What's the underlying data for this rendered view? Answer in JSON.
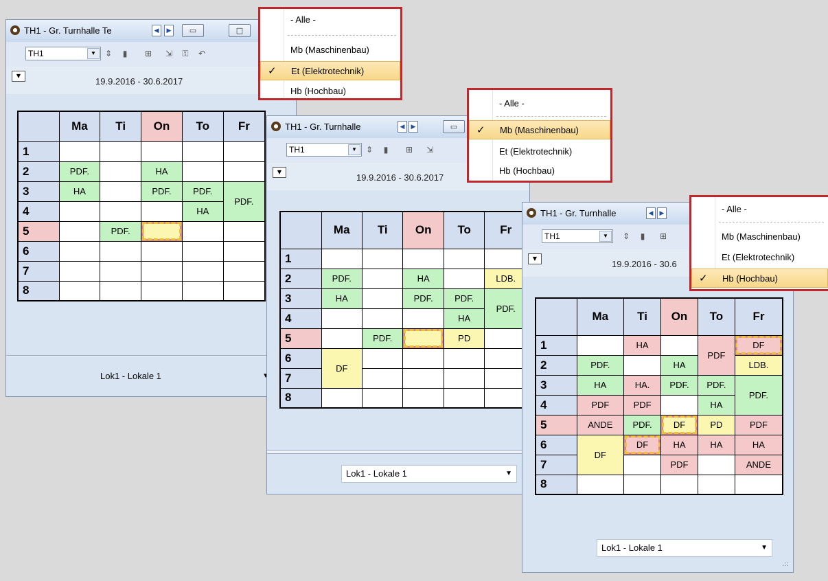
{
  "windows": [
    {
      "title": "TH1 - Gr. Turnhalle Te",
      "room_combo": "TH1",
      "date_range": "19.9.2016 - 30.6.2017",
      "days": [
        "Ma",
        "Ti",
        "On",
        "To",
        "Fr"
      ],
      "periods": [
        "1",
        "2",
        "3",
        "4",
        "5",
        "6",
        "7",
        "8"
      ],
      "footer_combo": "Lok1 - Lokale 1",
      "lesson_cells": [
        "PDF.",
        "HA",
        "HA",
        "PDF.",
        "PDF.",
        "PDF.",
        "HA",
        "PDF."
      ]
    },
    {
      "title": "TH1 - Gr. Turnhalle",
      "room_combo": "TH1",
      "date_range": "19.9.2016 - 30.6.2017",
      "days": [
        "Ma",
        "Ti",
        "On",
        "To",
        "Fr"
      ],
      "periods": [
        "1",
        "2",
        "3",
        "4",
        "5",
        "6",
        "7",
        "8"
      ],
      "footer_combo": "Lok1 - Lokale 1",
      "lesson_cells": [
        "PDF.",
        "HA",
        "LDB.",
        "HA",
        "PDF.",
        "PDF.",
        "PDF.",
        "HA",
        "PDF.",
        "PD",
        "DF"
      ]
    },
    {
      "title": "TH1 - Gr. Turnhalle",
      "room_combo": "TH1",
      "date_range": "19.9.2016 - 30.6",
      "days": [
        "Ma",
        "Ti",
        "On",
        "To",
        "Fr"
      ],
      "periods": [
        "1",
        "2",
        "3",
        "4",
        "5",
        "6",
        "7",
        "8"
      ],
      "footer_combo": "Lok1 - Lokale 1",
      "lesson_cells": [
        "HA",
        "PDF",
        "DF",
        "PDF.",
        "HA",
        "LDB.",
        "HA",
        "HA.",
        "PDF.",
        "PDF.",
        "PDF.",
        "PDF",
        "PDF",
        "HA",
        "ANDE",
        "PDF.",
        "DF",
        "PD",
        "PDF",
        "DF",
        "DF",
        "HA",
        "HA",
        "HA",
        "PDF",
        "ANDE"
      ]
    }
  ],
  "menus": [
    {
      "items": [
        "- Alle -",
        "Mb (Maschinenbau)",
        "Et (Elektrotechnik)",
        "Hb (Hochbau)"
      ],
      "checked": "Et (Elektrotechnik)"
    },
    {
      "items": [
        "- Alle -",
        "Mb (Maschinenbau)",
        "Et (Elektrotechnik)",
        "Hb (Hochbau)"
      ],
      "checked": "Mb (Maschinenbau)"
    },
    {
      "items": [
        "- Alle -",
        "Mb (Maschinenbau)",
        "Et (Elektrotechnik)",
        "Hb (Hochbau)"
      ],
      "checked": "Hb (Hochbau)"
    }
  ],
  "icons": {
    "check": "✓",
    "dropdown": "▼",
    "nav_prev": "◀",
    "nav_next": "▶"
  },
  "colors": {
    "green_cell": "#c3f2c3",
    "yellow_cell": "#fbf6b0",
    "pink_cell": "#f5c9c9",
    "highlight_border": "#c0272d",
    "checked_item": "#f7d88a"
  }
}
